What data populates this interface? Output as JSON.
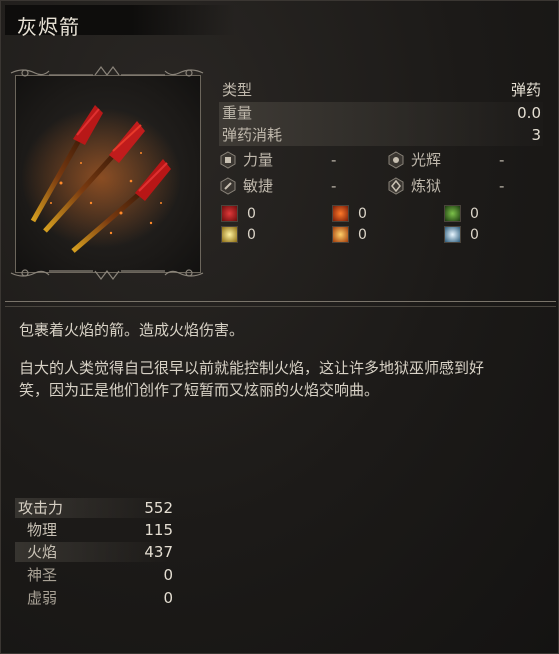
{
  "item": {
    "title": "灰烬箭"
  },
  "stats": [
    {
      "label": "类型",
      "value": "弹药"
    },
    {
      "label": "重量",
      "value": "0.0"
    },
    {
      "label": "弹药消耗",
      "value": "3"
    }
  ],
  "attributes": [
    {
      "name": "力量",
      "value": "-",
      "icon": "strength-icon"
    },
    {
      "name": "光辉",
      "value": "-",
      "icon": "radiance-icon"
    },
    {
      "name": "敏捷",
      "value": "-",
      "icon": "dexterity-icon"
    },
    {
      "name": "炼狱",
      "value": "-",
      "icon": "inferno-icon"
    }
  ],
  "resistances": [
    {
      "icon": "bleed-icon",
      "value": "0",
      "color": "#b02020"
    },
    {
      "icon": "burn-icon",
      "value": "0",
      "color": "#d8501a"
    },
    {
      "icon": "poison-icon",
      "value": "0",
      "color": "#4c8a2a"
    },
    {
      "icon": "radiant-icon",
      "value": "0",
      "color": "#e2c43a"
    },
    {
      "icon": "fire-icon",
      "value": "0",
      "color": "#e07a1a"
    },
    {
      "icon": "frost-icon",
      "value": "0",
      "color": "#8ec6e6"
    }
  ],
  "description": {
    "line1": "包裹着火焰的箭。造成火焰伤害。",
    "line2": "自大的人类觉得自己很早以前就能控制火焰，这让许多地狱巫师感到好",
    "line3": "笑，因为正是他们创作了短暂而又炫丽的火焰交响曲。"
  },
  "attack": {
    "label": "攻击力",
    "value": "552",
    "breakdown": [
      {
        "label": "物理",
        "value": "115"
      },
      {
        "label": "火焰",
        "value": "437"
      },
      {
        "label": "神圣",
        "value": "0"
      },
      {
        "label": "虚弱",
        "value": "0"
      }
    ]
  }
}
